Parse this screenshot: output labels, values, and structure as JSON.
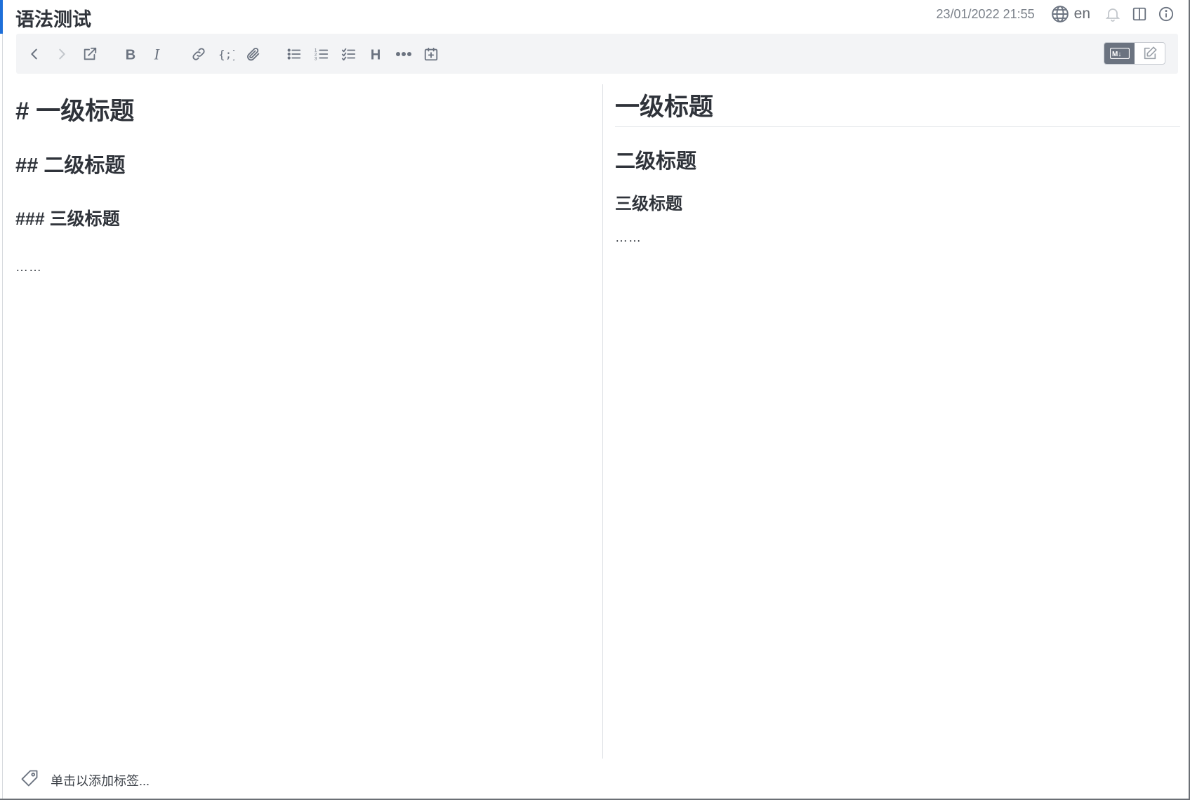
{
  "note": {
    "title": "语法测试",
    "datetime": "23/01/2022 21:55",
    "language": "en"
  },
  "header_icons": [
    "globe-icon",
    "bell-icon",
    "split-view-icon",
    "info-icon"
  ],
  "toolbar": {
    "buttons": [
      "back-icon",
      "forward-icon",
      "external-edit-icon",
      "bold-icon",
      "italic-icon",
      "link-icon",
      "code-icon",
      "attachment-icon",
      "bulleted-list-icon",
      "numbered-list-icon",
      "checklist-icon",
      "heading-icon",
      "horizontal-rule-icon",
      "insert-datetime-icon"
    ],
    "mode_markdown_label": "M↓"
  },
  "editor": {
    "h1": "# 一级标题",
    "h2": "## 二级标题",
    "h3": "### 三级标题",
    "paragraph": "……"
  },
  "preview": {
    "h1": "一级标题",
    "h2": "二级标题",
    "h3": "三级标题",
    "paragraph": "……"
  },
  "tags": {
    "placeholder": "单击以添加标签..."
  },
  "colors": {
    "accent": "#1e6fd9",
    "toolbar_bg": "#f3f4f6",
    "icon": "#6b7380",
    "text": "#2f333a"
  }
}
